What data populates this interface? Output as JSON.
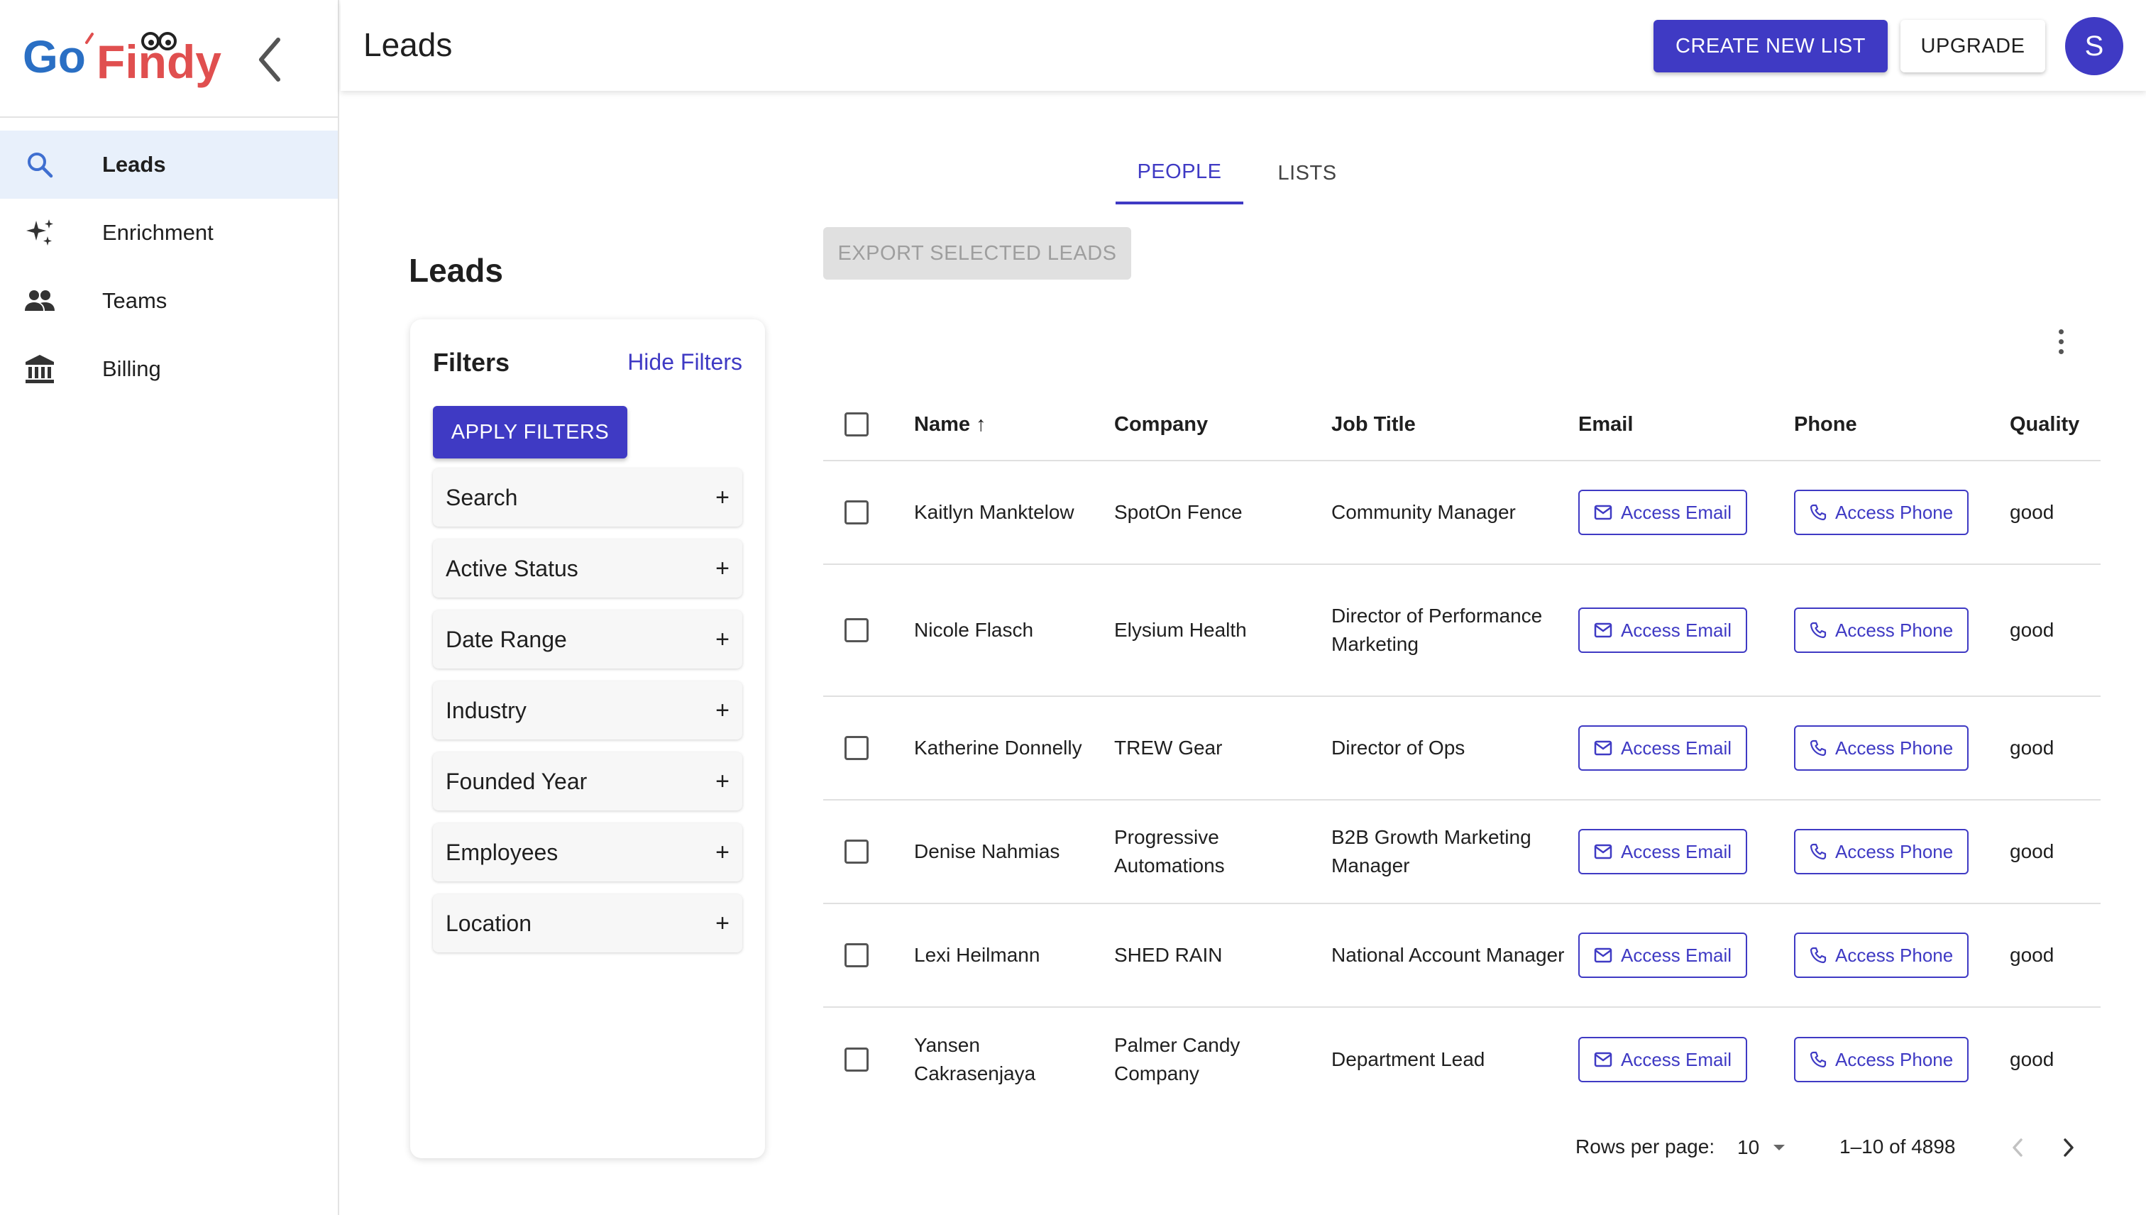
{
  "brand": {
    "logo_text_go": "Go",
    "logo_text_findy": "Findy"
  },
  "sidebar": {
    "items": [
      {
        "label": "Leads",
        "icon": "search-icon",
        "active": true
      },
      {
        "label": "Enrichment",
        "icon": "sparkles-icon",
        "active": false
      },
      {
        "label": "Teams",
        "icon": "people-icon",
        "active": false
      },
      {
        "label": "Billing",
        "icon": "bank-icon",
        "active": false
      }
    ]
  },
  "header": {
    "title": "Leads",
    "create_label": "CREATE NEW LIST",
    "upgrade_label": "UPGRADE",
    "avatar_initial": "S"
  },
  "tabs": [
    {
      "label": "PEOPLE",
      "active": true
    },
    {
      "label": "LISTS",
      "active": false
    }
  ],
  "section_title": "Leads",
  "export_label": "EXPORT SELECTED LEADS",
  "filters": {
    "title": "Filters",
    "hide_label": "Hide Filters",
    "apply_label": "APPLY FILTERS",
    "items": [
      "Search",
      "Active Status",
      "Date Range",
      "Industry",
      "Founded Year",
      "Employees",
      "Location"
    ],
    "expand_symbol": "+"
  },
  "table": {
    "columns": {
      "name": "Name",
      "sort_arrow": "↑",
      "company": "Company",
      "job_title": "Job Title",
      "email": "Email",
      "phone": "Phone",
      "quality": "Quality"
    },
    "access_email_label": "Access Email",
    "access_phone_label": "Access Phone",
    "rows": [
      {
        "name": "Kaitlyn Manktelow",
        "company": "SpotOn Fence",
        "job_title": "Community Manager",
        "quality": "good"
      },
      {
        "name": "Nicole Flasch",
        "company": "Elysium Health",
        "job_title": "Director of Performance Marketing",
        "quality": "good"
      },
      {
        "name": "Katherine Donnelly",
        "company": "TREW Gear",
        "job_title": "Director of Ops",
        "quality": "good"
      },
      {
        "name": "Denise Nahmias",
        "company": "Progressive Automations",
        "job_title": "B2B Growth Marketing Manager",
        "quality": "good"
      },
      {
        "name": "Lexi Heilmann",
        "company": "SHED RAIN",
        "job_title": "National Account Manager",
        "quality": "good"
      },
      {
        "name": "Yansen Cakrasenjaya",
        "company": "Palmer Candy Company",
        "job_title": "Department Lead",
        "quality": "good"
      }
    ]
  },
  "pagination": {
    "rows_per_page_label": "Rows per page:",
    "rows_per_page_value": "10",
    "range_text": "1–10 of 4898"
  },
  "colors": {
    "accent": "#3f3ac4",
    "active_nav_bg": "#e8f0fb",
    "logo_go": "#2a6fc4",
    "logo_findy": "#e04f4f"
  }
}
